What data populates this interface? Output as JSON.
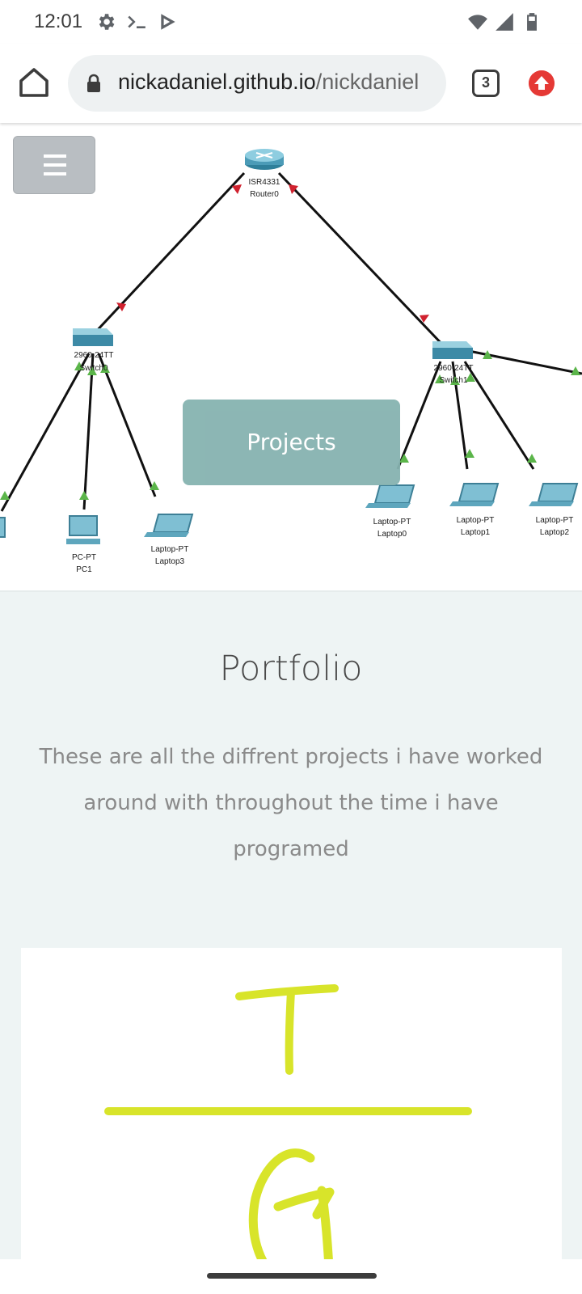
{
  "status_bar": {
    "time": "12:01",
    "icons_left": [
      "settings-gear-icon",
      "terminal-prompt-icon",
      "play-store-icon"
    ],
    "icons_right": [
      "wifi-icon",
      "cellular-signal-icon",
      "battery-icon"
    ]
  },
  "browser": {
    "url_domain": "nickadaniel.github.io",
    "url_path": "/nickdaniel",
    "tab_count": "3",
    "accent_update_color": "#e53935"
  },
  "hero": {
    "menu_button_icon": "hamburger-menu-icon",
    "projects_button_label": "Projects",
    "network_diagram": {
      "router": {
        "model": "ISR4331",
        "name": "Router0"
      },
      "switches": [
        {
          "model": "2960-24TT",
          "name": "Switch0"
        },
        {
          "model": "2960-24TT",
          "name": "Switch1"
        }
      ],
      "end_devices": [
        {
          "model": "PC-PT",
          "name": "PC1"
        },
        {
          "model": "Laptop-PT",
          "name": "Laptop3"
        },
        {
          "model": "Laptop-PT",
          "name": "Laptop0"
        },
        {
          "model": "Laptop-PT",
          "name": "Laptop1"
        },
        {
          "model": "Laptop-PT",
          "name": "Laptop2"
        }
      ]
    }
  },
  "portfolio": {
    "title": "Portfolio",
    "description": "These are all the diffrent projects i have worked around with throughout the time i have programed",
    "logo_color": "#d8e42a"
  }
}
